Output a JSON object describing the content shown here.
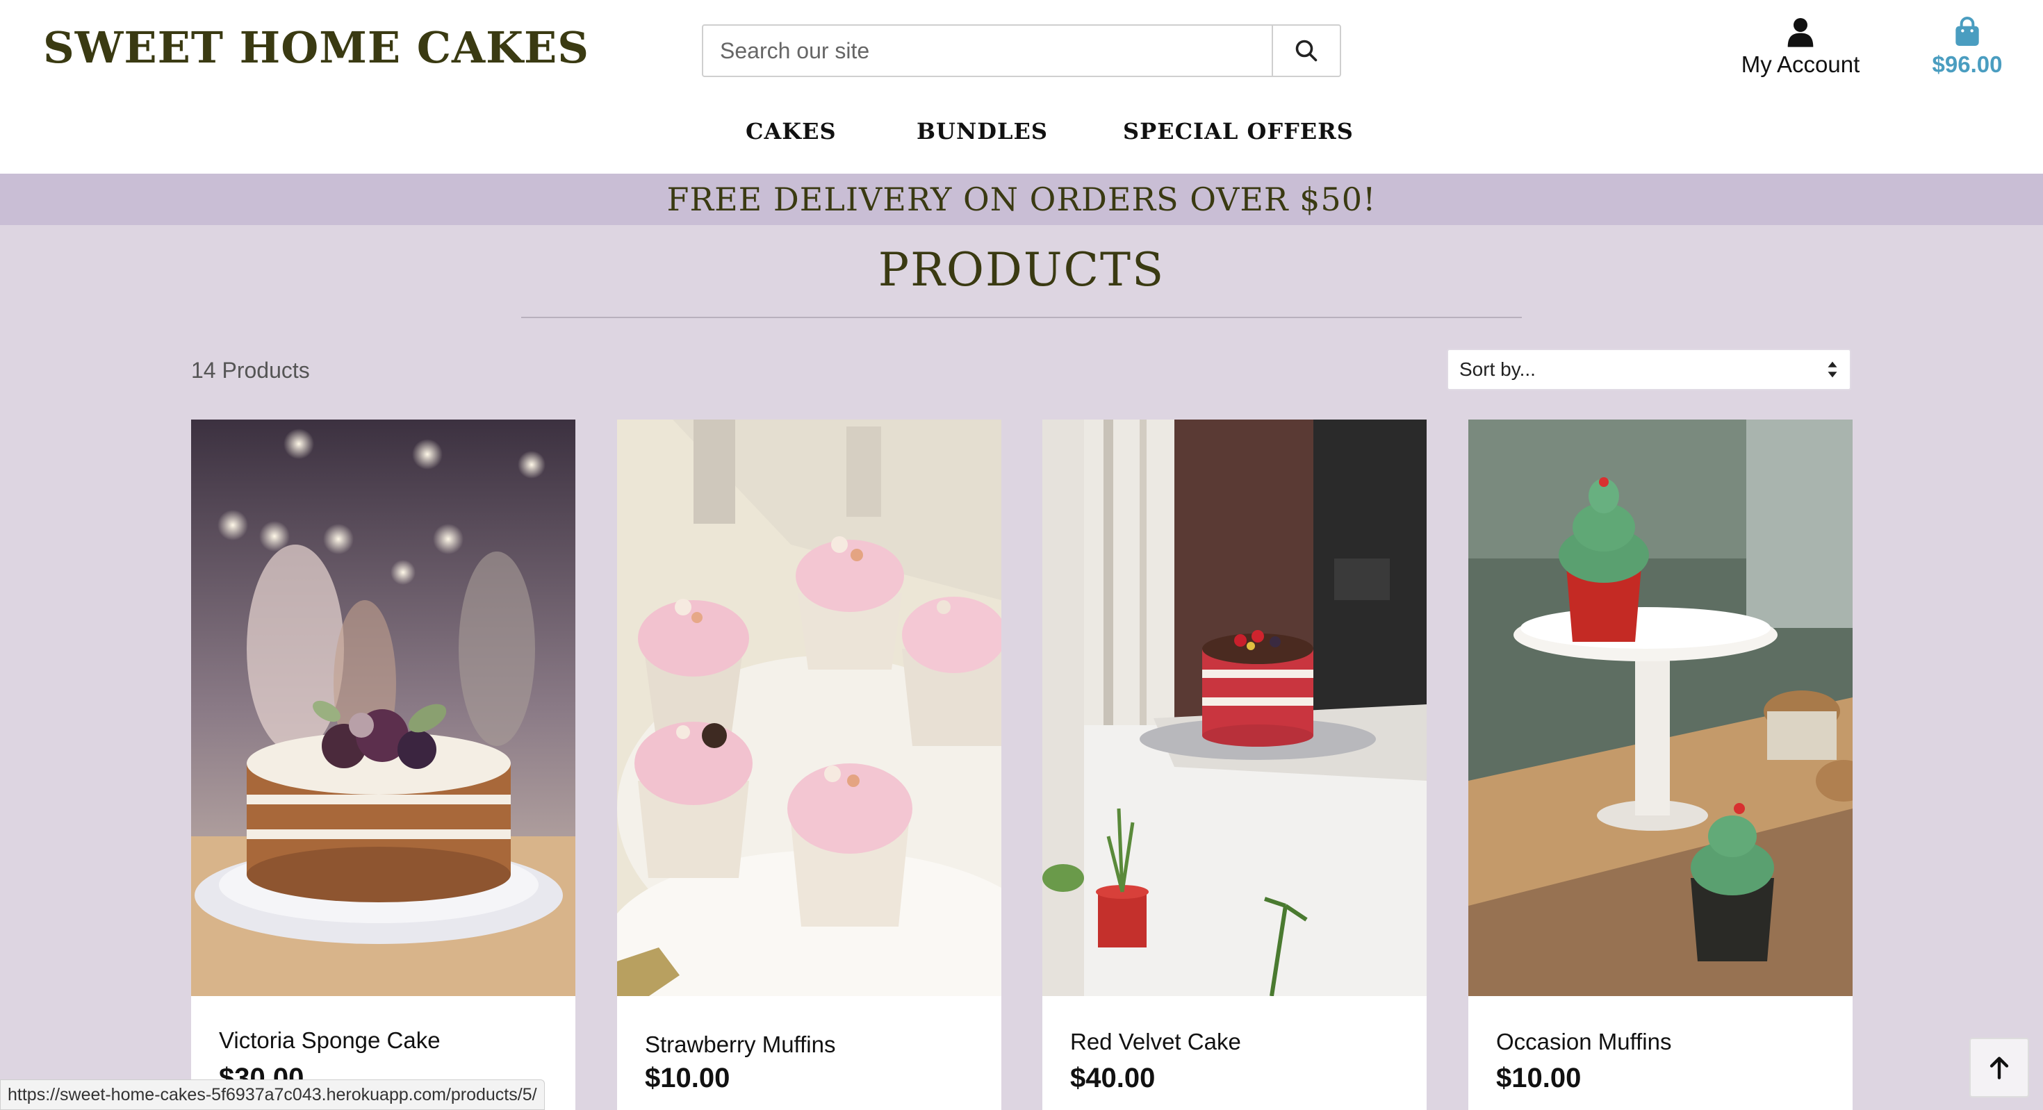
{
  "brand": "SWEET HOME CAKES",
  "search": {
    "placeholder": "Search our site"
  },
  "account": {
    "label": "My Account"
  },
  "bag": {
    "total": "$96.00"
  },
  "nav": {
    "items": [
      "CAKES",
      "BUNDLES",
      "SPECIAL OFFERS"
    ]
  },
  "banner": "FREE DELIVERY ON ORDERS OVER $50!",
  "page_title": "PRODUCTS",
  "product_count": "14 Products",
  "sort": {
    "selected": "Sort by..."
  },
  "products": [
    {
      "name": "Victoria Sponge Cake",
      "price": "$30.00"
    },
    {
      "name": "Strawberry Muffins",
      "price": "$10.00"
    },
    {
      "name": "Red Velvet Cake",
      "price": "$40.00"
    },
    {
      "name": "Occasion Muffins",
      "price": "$10.00"
    }
  ],
  "status_url": "https://sweet-home-cakes-5f6937a7c043.herokuapp.com/products/5/",
  "icons": {
    "search": "search-icon",
    "account": "user-icon",
    "bag": "shopping-bag-icon",
    "sort": "sort-arrows-icon",
    "to_top": "arrow-up-icon"
  },
  "colors": {
    "brand": "#3a3a12",
    "banner_bg": "#c9bed5",
    "page_bg": "#ddd5e1",
    "bag_accent": "#4a9dc0"
  }
}
